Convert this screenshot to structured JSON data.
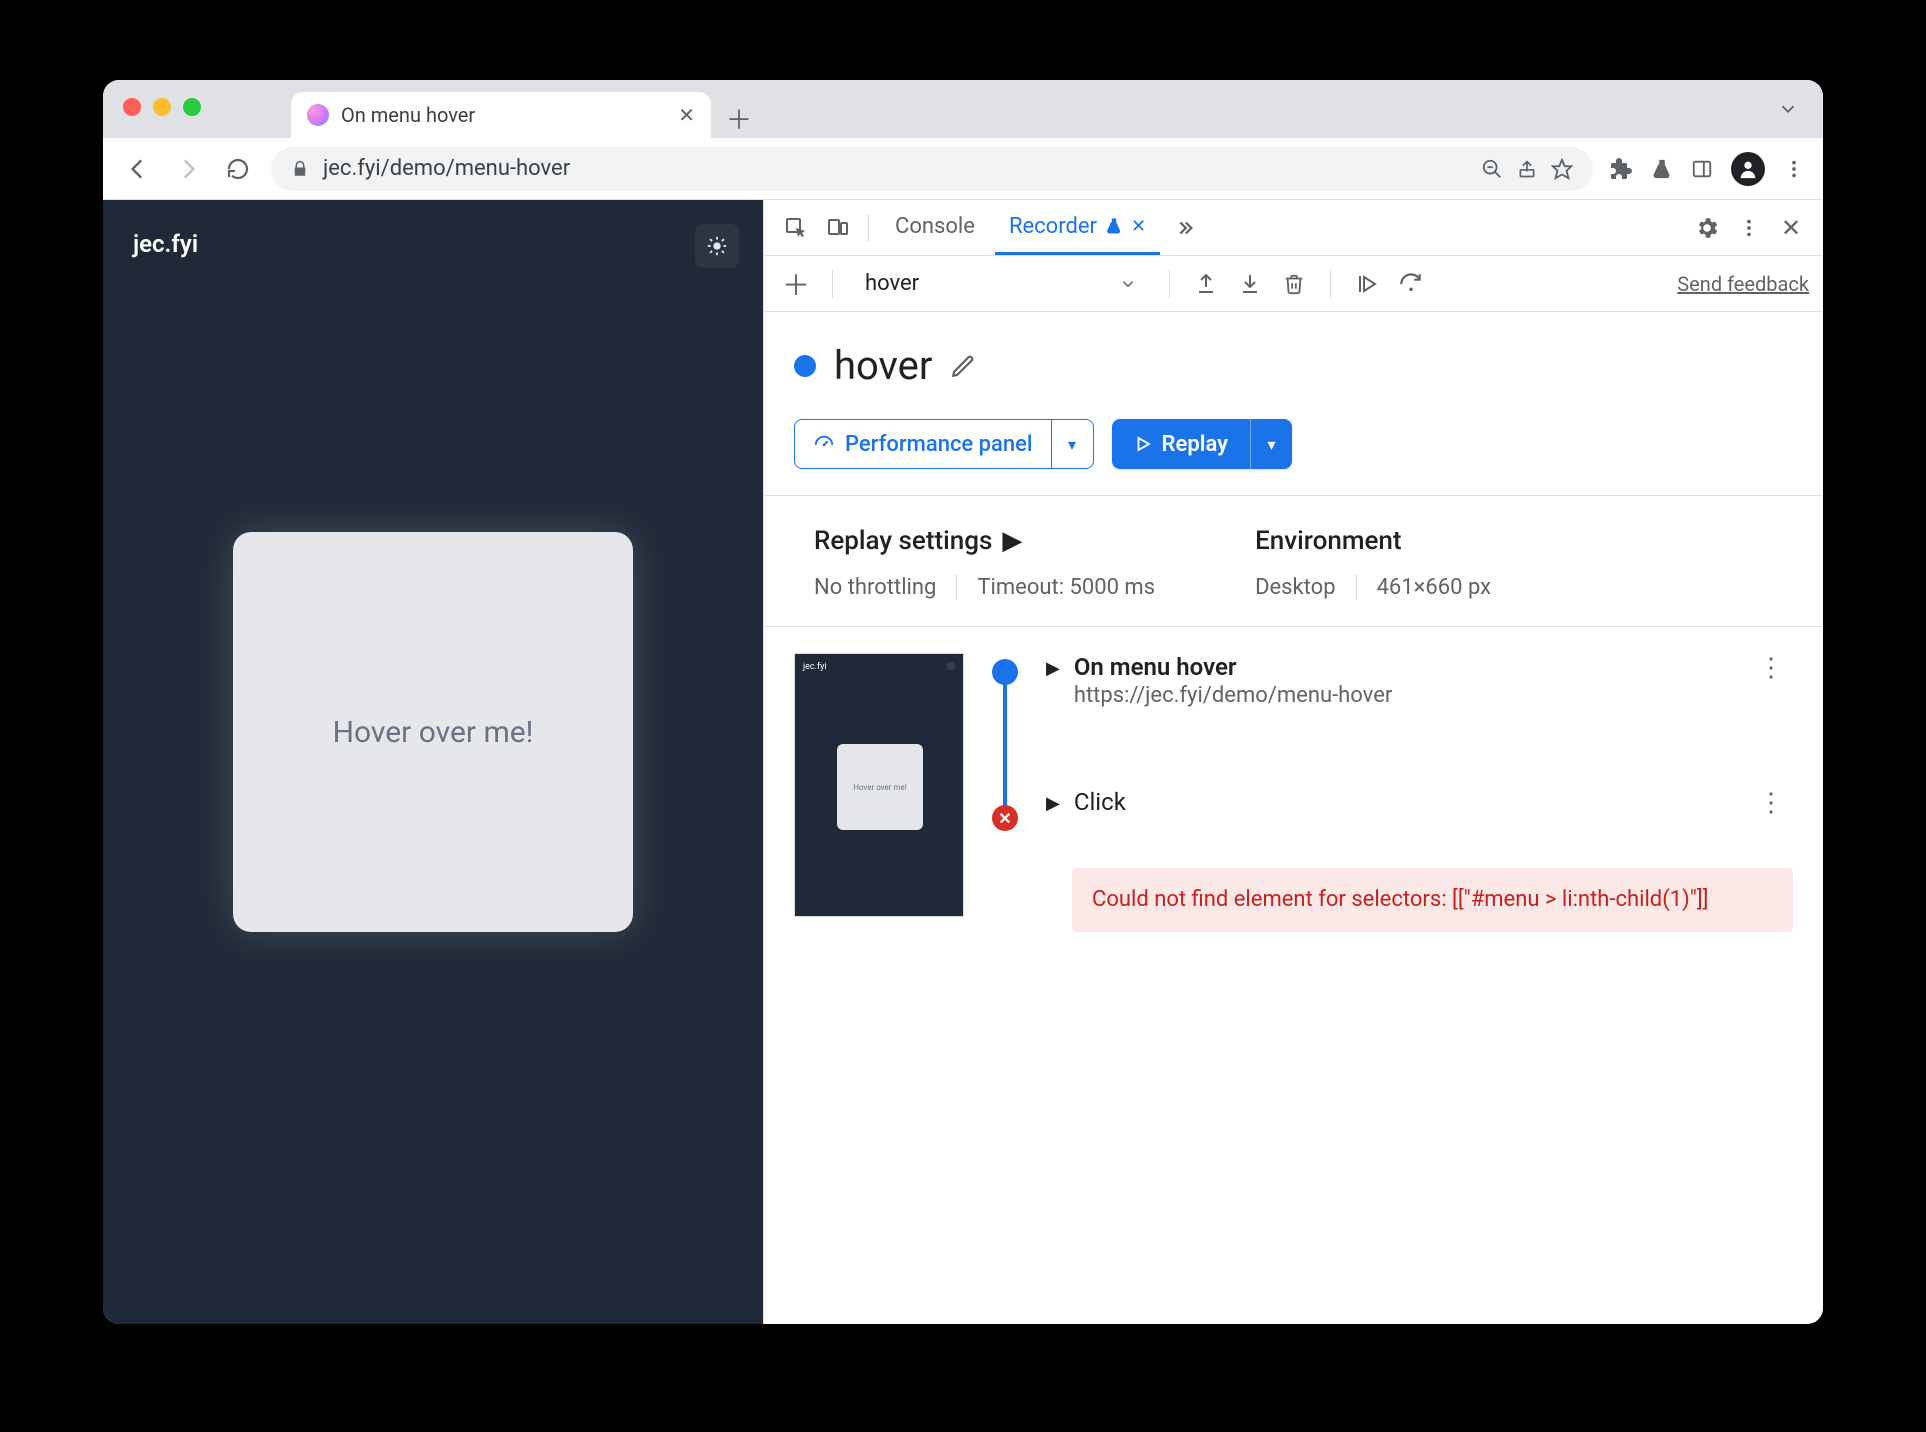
{
  "tab": {
    "title": "On menu hover"
  },
  "url": "jec.fyi/demo/menu-hover",
  "page": {
    "brand": "jec.fyi",
    "card_text": "Hover over me!"
  },
  "devtools": {
    "tabs": {
      "console": "Console",
      "recorder": "Recorder"
    },
    "recorder": {
      "select_label": "hover",
      "feedback": "Send feedback",
      "title": "hover",
      "perf_panel": "Performance panel",
      "replay": "Replay",
      "settings": {
        "replay_heading": "Replay settings",
        "throttling": "No throttling",
        "timeout": "Timeout: 5000 ms",
        "env_heading": "Environment",
        "env_device": "Desktop",
        "env_size": "461×660 px"
      },
      "steps": {
        "s1_title": "On menu hover",
        "s1_url": "https://jec.fyi/demo/menu-hover",
        "s2_title": "Click",
        "error": "Could not find element for selectors: [[\"#menu > li:nth-child(1)\"]]"
      },
      "thumb": {
        "brand": "jec.fyi",
        "card_text": "Hover over me!"
      }
    }
  }
}
